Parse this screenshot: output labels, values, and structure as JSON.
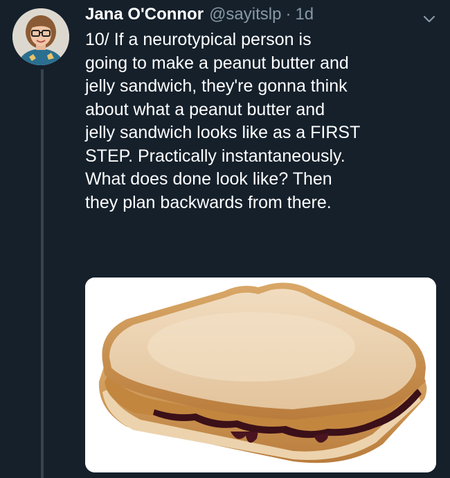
{
  "tweet": {
    "author_name": "Jana O'Connor",
    "handle": "@sayitslp",
    "separator": "·",
    "timestamp": "1d",
    "text": "10/ If a neurotypical person is\ngoing to make a peanut butter and\njelly sandwich, they're gonna think\nabout what a peanut butter and\njelly sandwich looks like as a FIRST\nSTEP. Practically instantaneously.\nWhat does done look like? Then\nthey plan backwards from there.",
    "media": "peanut-butter-jelly-sandwich-photo"
  },
  "icons": {
    "menu": "chevron-down-icon"
  },
  "colors": {
    "background": "#15202b",
    "secondary_text": "#8899a6",
    "thread_line": "#38444d"
  }
}
